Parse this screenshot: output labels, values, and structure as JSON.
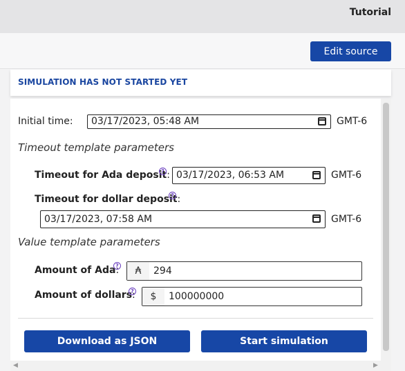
{
  "header": {
    "tutorial_label": "Tutorial"
  },
  "toolbar": {
    "edit_source_label": "Edit source"
  },
  "status": {
    "text": "SIMULATION HAS NOT STARTED YET"
  },
  "form": {
    "initial_time": {
      "label": "Initial time:",
      "value": "03/17/2023, 05:48 AM",
      "timezone": "GMT-6"
    },
    "timeout_section_title": "Timeout template parameters",
    "ada_deposit": {
      "label": "Timeout for Ada deposit",
      "suffix": ":",
      "help": "?",
      "value": "03/17/2023, 06:53 AM",
      "timezone": "GMT-6"
    },
    "dollar_deposit": {
      "label": "Timeout for dollar deposit",
      "suffix": ":",
      "help": "?",
      "value": "03/17/2023, 07:58 AM",
      "timezone": "GMT-6"
    },
    "value_section_title": "Value template parameters",
    "amount_ada": {
      "label": "Amount of Ada",
      "suffix": ":",
      "help": "?",
      "currency": "₳",
      "value": "294"
    },
    "amount_dollars": {
      "label": "Amount of dollars",
      "suffix": ":",
      "help": "?",
      "currency": "$",
      "value": "100000000"
    }
  },
  "actions": {
    "download_label": "Download as JSON",
    "start_label": "Start simulation"
  },
  "scroll": {
    "left_arrow": "◀",
    "right_arrow": "▶"
  },
  "colors": {
    "primary": "#1747a6",
    "status_text": "#1a46a0",
    "help_icon": "#6a3fbf"
  }
}
